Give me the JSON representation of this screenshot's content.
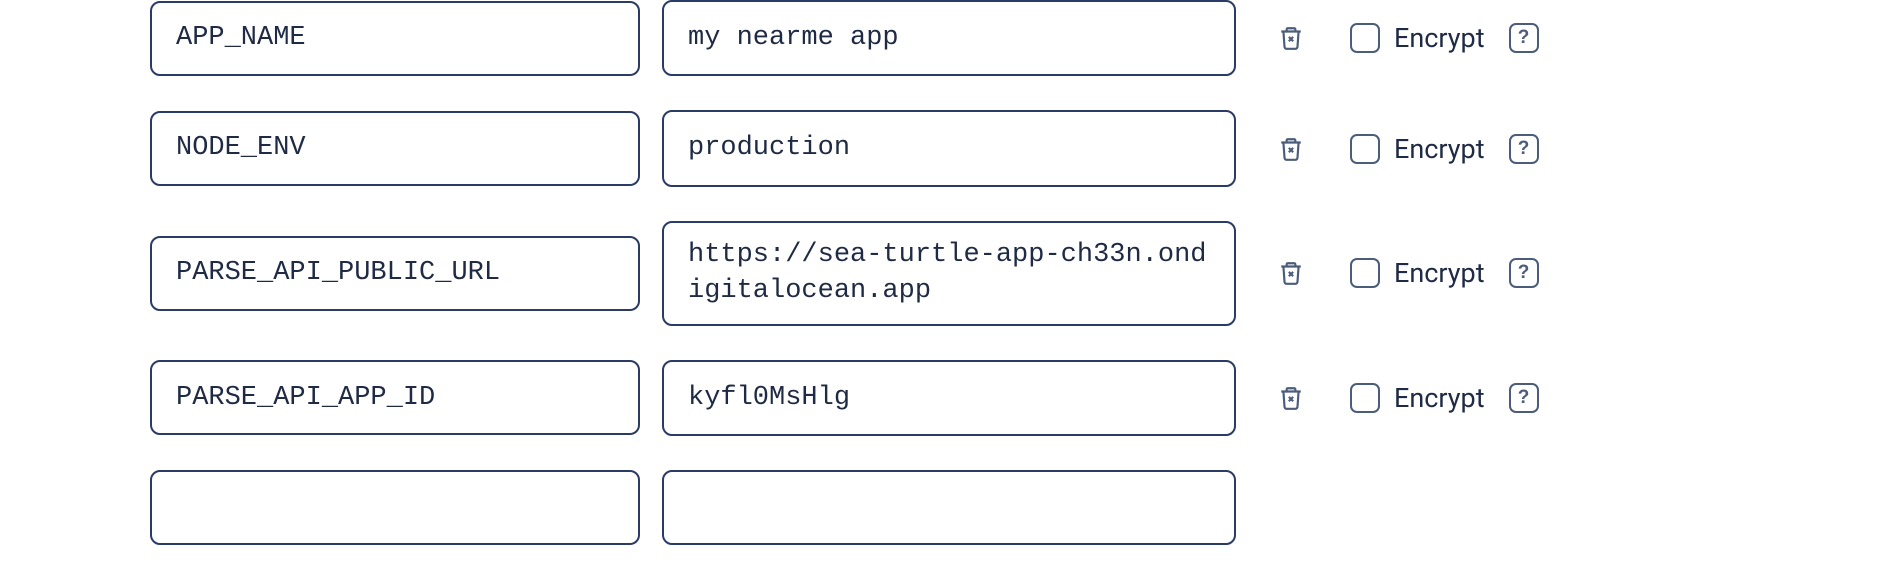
{
  "encrypt_label": "Encrypt",
  "help_glyph": "?",
  "rows": [
    {
      "key": "APP_NAME",
      "value": "my nearme app",
      "multiline": false
    },
    {
      "key": "NODE_ENV",
      "value": "production",
      "multiline": false
    },
    {
      "key": "PARSE_API_PUBLIC_URL",
      "value": "https://sea-turtle-app-ch33n.ondigitalocean.app",
      "multiline": true
    },
    {
      "key": "PARSE_API_APP_ID",
      "value": "kyfl0MsHlg",
      "multiline": false
    },
    {
      "key": "",
      "value": "",
      "multiline": false
    }
  ]
}
